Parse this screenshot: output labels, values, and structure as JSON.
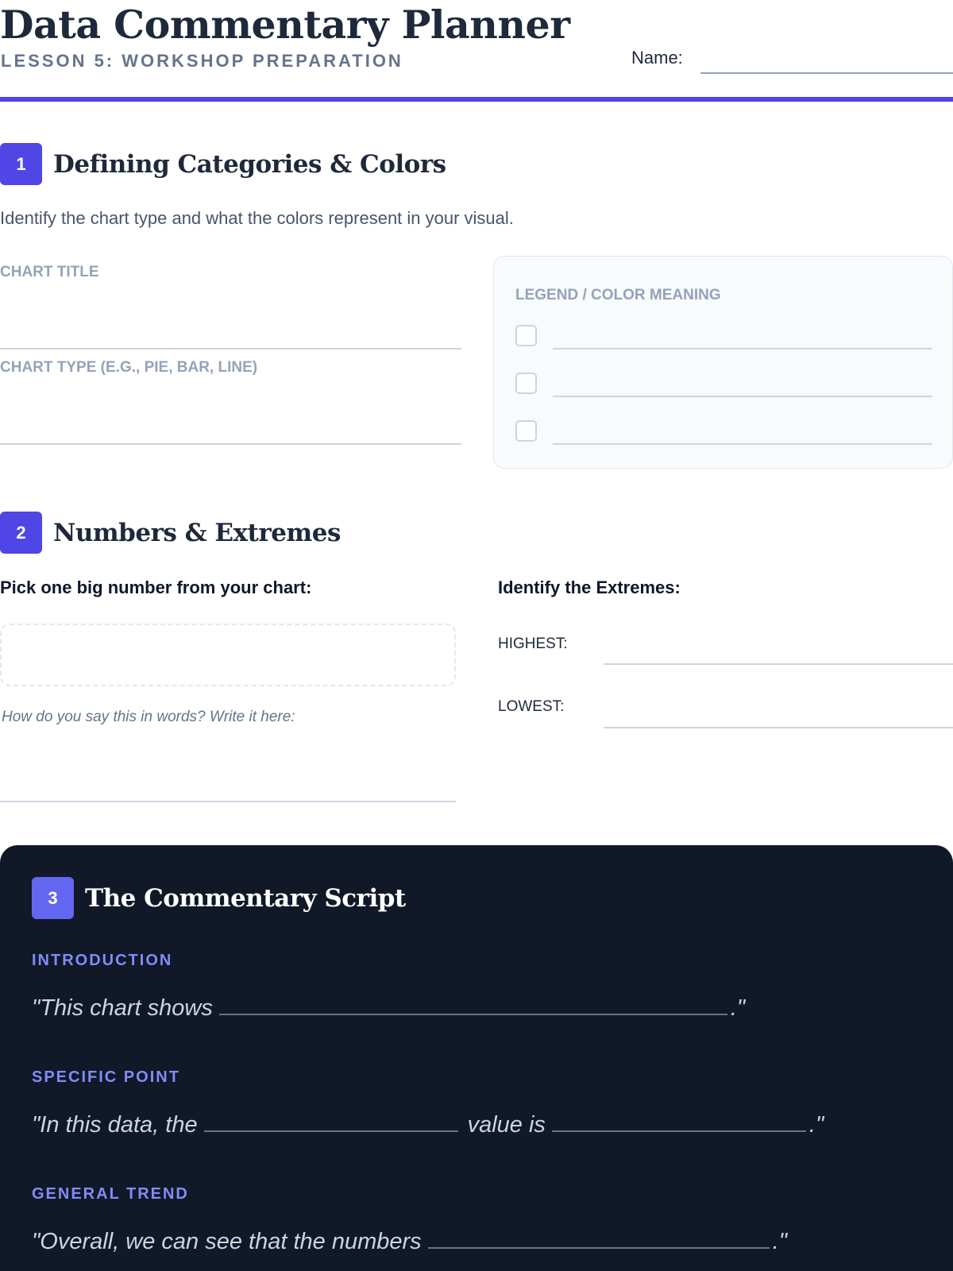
{
  "header": {
    "title": "Data Commentary Planner",
    "subtitle": "Lesson 5: Workshop Preparation",
    "name_label": "Name:",
    "accent_color": "#4f46e5"
  },
  "section1": {
    "number": "1",
    "title": "Defining Categories & Colors",
    "description": "Identify the chart type and what the colors represent in your visual.",
    "chart_title_label": "Chart Title",
    "chart_type_label": "Chart Type (e.g., Pie, Bar, Line)",
    "legend_label": "Legend / Color Meaning"
  },
  "section2": {
    "number": "2",
    "title": "Numbers & Extremes",
    "big_number_label": "Pick one big number from your chart:",
    "words_hint": "How do you say this in words? Write it here:",
    "extremes_label": "Identify the Extremes:",
    "highest_label": "HIGHEST:",
    "lowest_label": "LOWEST:"
  },
  "section3": {
    "number": "3",
    "title": "The Commentary Script",
    "intro_label": "Introduction",
    "intro_start": "\"This chart shows",
    "intro_end": ".\"",
    "specific_label": "Specific Point",
    "specific_start": "\"In this data, the",
    "specific_mid": "value is",
    "specific_end": ".\"",
    "trend_label": "General Trend",
    "trend_start": "\"Overall, we can see that the numbers",
    "trend_end": ".\""
  }
}
